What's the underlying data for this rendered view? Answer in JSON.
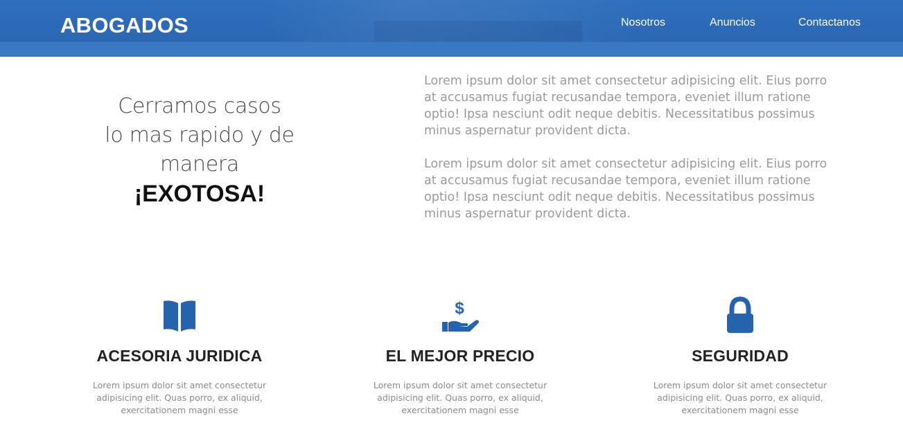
{
  "header": {
    "brand": "ABOGADOS",
    "nav": [
      "Nosotros",
      "Anuncios",
      "Contactanos"
    ]
  },
  "colors": {
    "header_blue": "#2b67b4",
    "icon_blue": "#2563ad",
    "heading_dark": "#222222",
    "body_gray": "#9a9a9a"
  },
  "hero": {
    "line1": "Cerramos casos",
    "line2": "lo mas rapido y de",
    "line3": "manera",
    "emphasis": "¡EXOTOSA!",
    "paragraphs": [
      "Lorem ipsum dolor sit amet consectetur adipisicing elit. Eius porro at accusamus fugiat recusandae tempora, eveniet illum ratione optio! Ipsa nesciunt odit neque debitis. Necessitatibus possimus minus aspernatur provident dicta.",
      "Lorem ipsum dolor sit amet consectetur adipisicing elit. Eius porro at accusamus fugiat recusandae tempora, eveniet illum ratione optio! Ipsa nesciunt odit neque debitis. Necessitatibus possimus minus aspernatur provident dicta."
    ]
  },
  "features": [
    {
      "icon": "book-open-icon",
      "title": "ACESORIA JURIDICA",
      "text": "Lorem ipsum dolor sit amet consectetur adipisicing elit. Quas porro, ex aliquid, exercitationem magni esse"
    },
    {
      "icon": "hand-holding-dollar-icon",
      "title": "EL MEJOR PRECIO",
      "text": "Lorem ipsum dolor sit amet consectetur adipisicing elit. Quas porro, ex aliquid, exercitationem magni esse"
    },
    {
      "icon": "lock-icon",
      "title": "SEGURIDAD",
      "text": "Lorem ipsum dolor sit amet consectetur adipisicing elit. Quas porro, ex aliquid, exercitationem magni esse"
    }
  ]
}
